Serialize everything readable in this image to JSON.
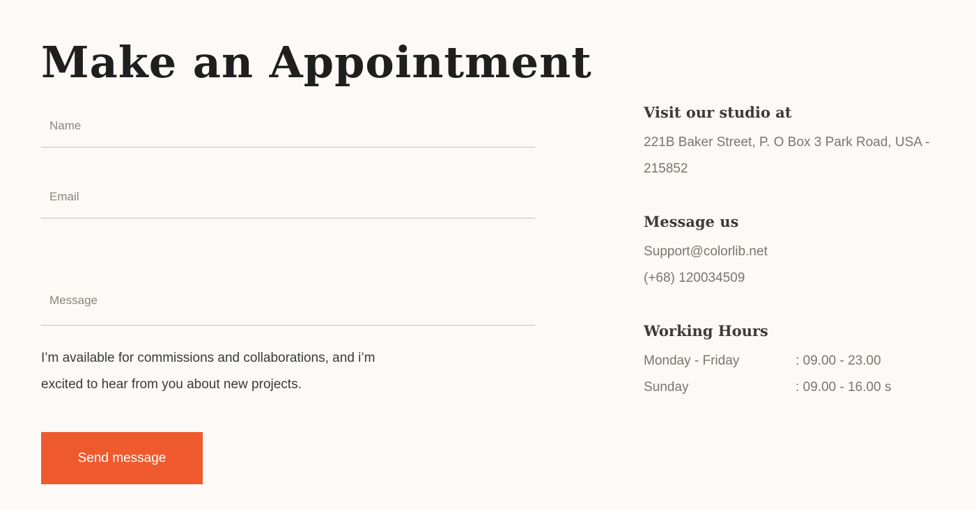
{
  "title": "Make an Appointment",
  "form": {
    "name_placeholder": "Name",
    "email_placeholder": "Email",
    "message_placeholder": "Message",
    "intro": "I’m available for commissions and collaborations, and i’m excited to hear from you about new projects.",
    "send_label": "Send message",
    "accent_color": "#ee5a2e"
  },
  "studio": {
    "heading": "Visit our studio at",
    "address": "221B Baker Street, P. O Box 3 Park Road, USA - 215852"
  },
  "contact": {
    "heading": "Message us",
    "email": "Support@colorlib.net",
    "phone": "(+68) 120034509 "
  },
  "hours": {
    "heading": "Working Hours",
    "rows": [
      {
        "day": "Monday - Friday",
        "time": ": 09.00 - 23.00"
      },
      {
        "day": "Sunday",
        "time": ": 09.00 - 16.00 s"
      }
    ]
  }
}
